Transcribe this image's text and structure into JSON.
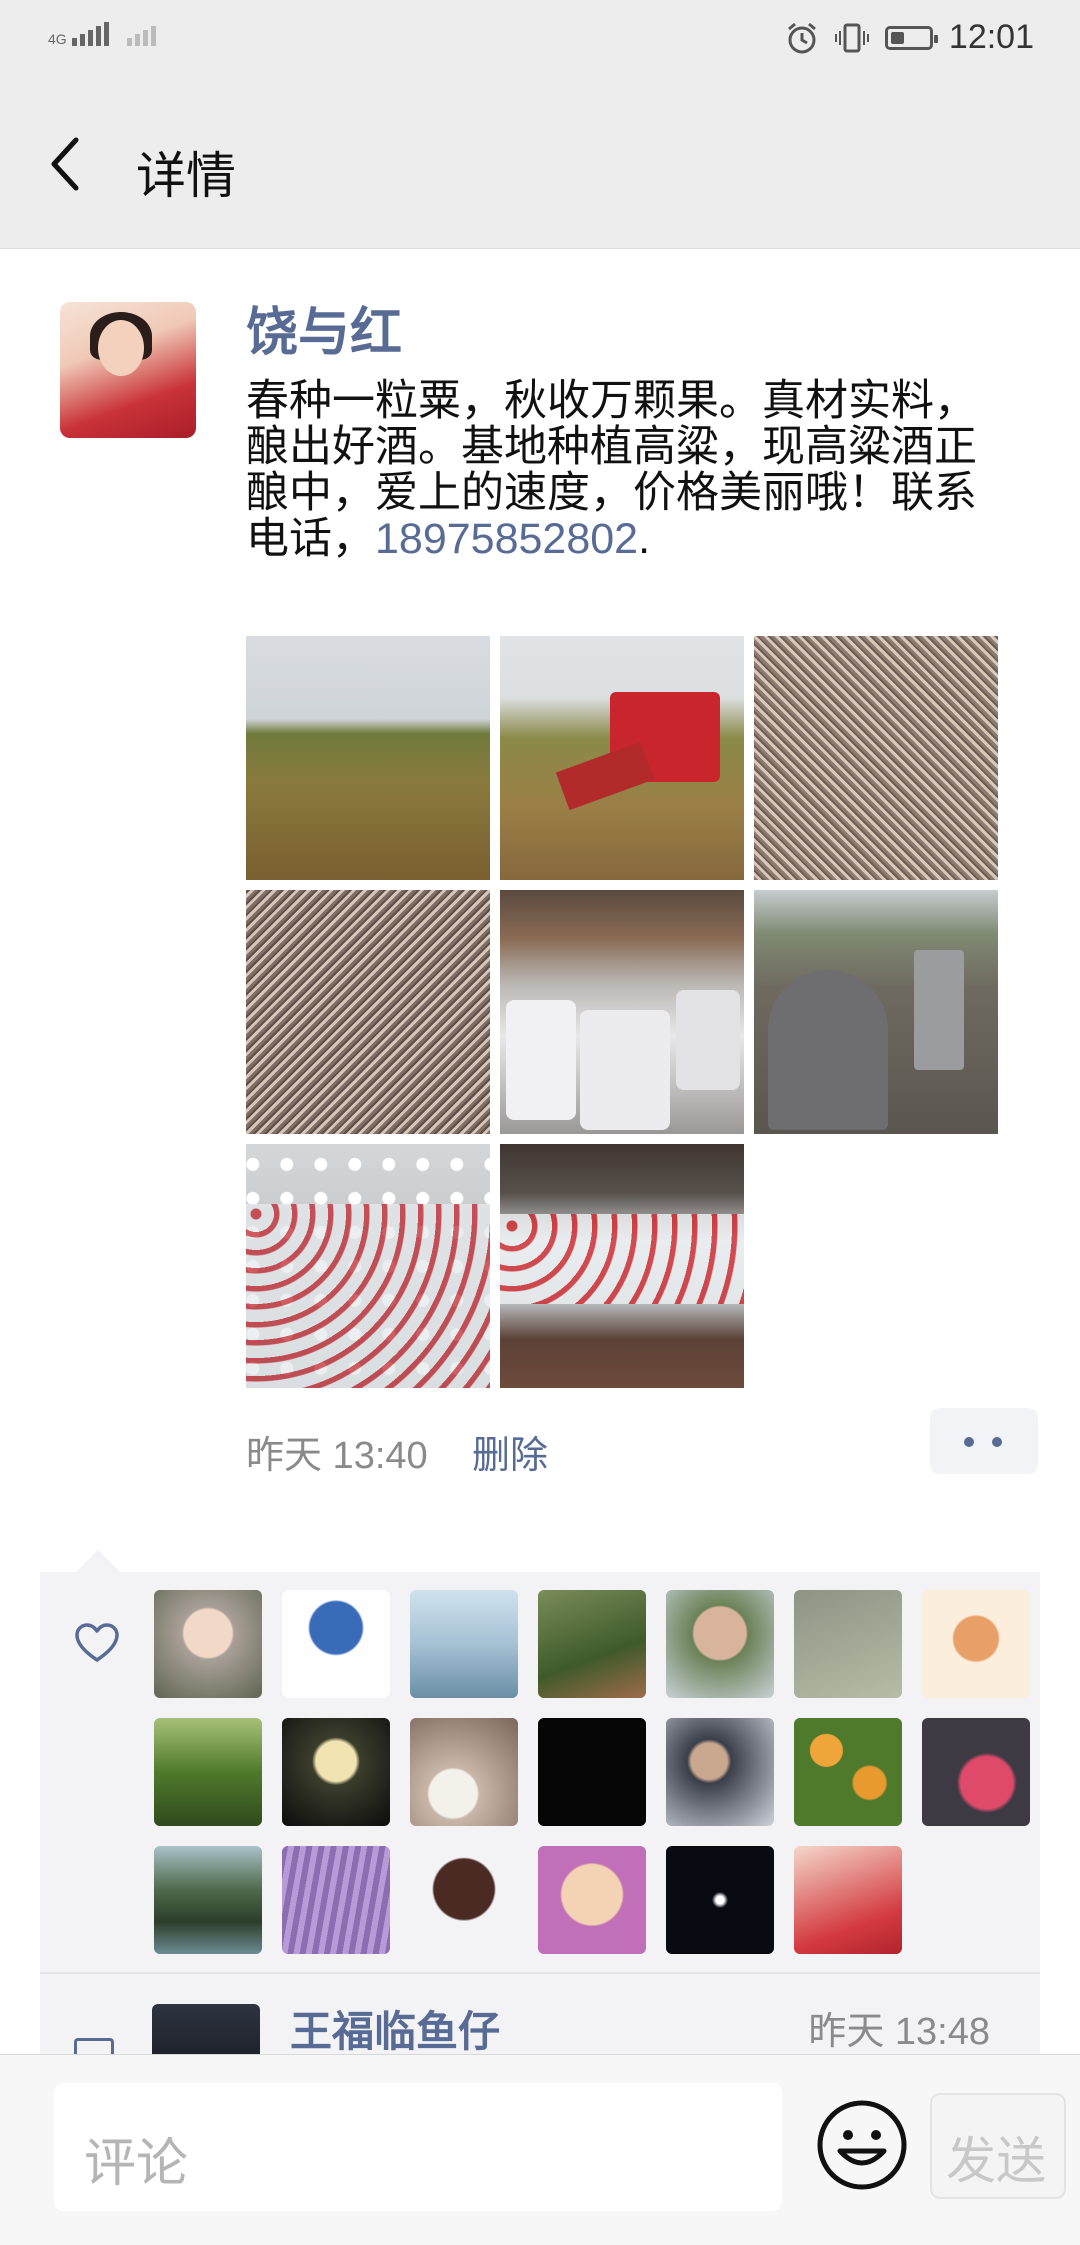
{
  "status_bar": {
    "network": "4G",
    "time": "12:01",
    "icons": [
      "signal-icon",
      "alarm-icon",
      "vibrate-icon",
      "battery-icon"
    ],
    "battery_level": 0.35
  },
  "header": {
    "back_icon": "chevron-left-icon",
    "title": "详情"
  },
  "post": {
    "author": "饶与红",
    "text_before_phone": "春种一粒粟，秋收万颗果。真材实料，酿出好酒。基地种植高粱，现高粱酒正酿中，爱上的速度，价格美丽哦！联系电话，",
    "phone": "18975852802",
    "text_after_phone": ".",
    "photos": [
      "sorghum-field",
      "harvester",
      "sorghum-grain-1",
      "sorghum-grain-2",
      "fermentation-barrels",
      "distillery-still",
      "bottles-1",
      "bottles-2"
    ],
    "time": "昨天 13:40",
    "delete_label": "删除",
    "more_icon": "more-dots-icon"
  },
  "likes": {
    "icon": "heart-icon",
    "avatar_count": 20
  },
  "comments": [
    {
      "name": "王福临鱼仔",
      "time": "昨天 13:48",
      "icon": "comment-icon"
    }
  ],
  "input_bar": {
    "placeholder": "评论",
    "emoji_icon": "smile-emoji-icon",
    "send_label": "发送"
  }
}
